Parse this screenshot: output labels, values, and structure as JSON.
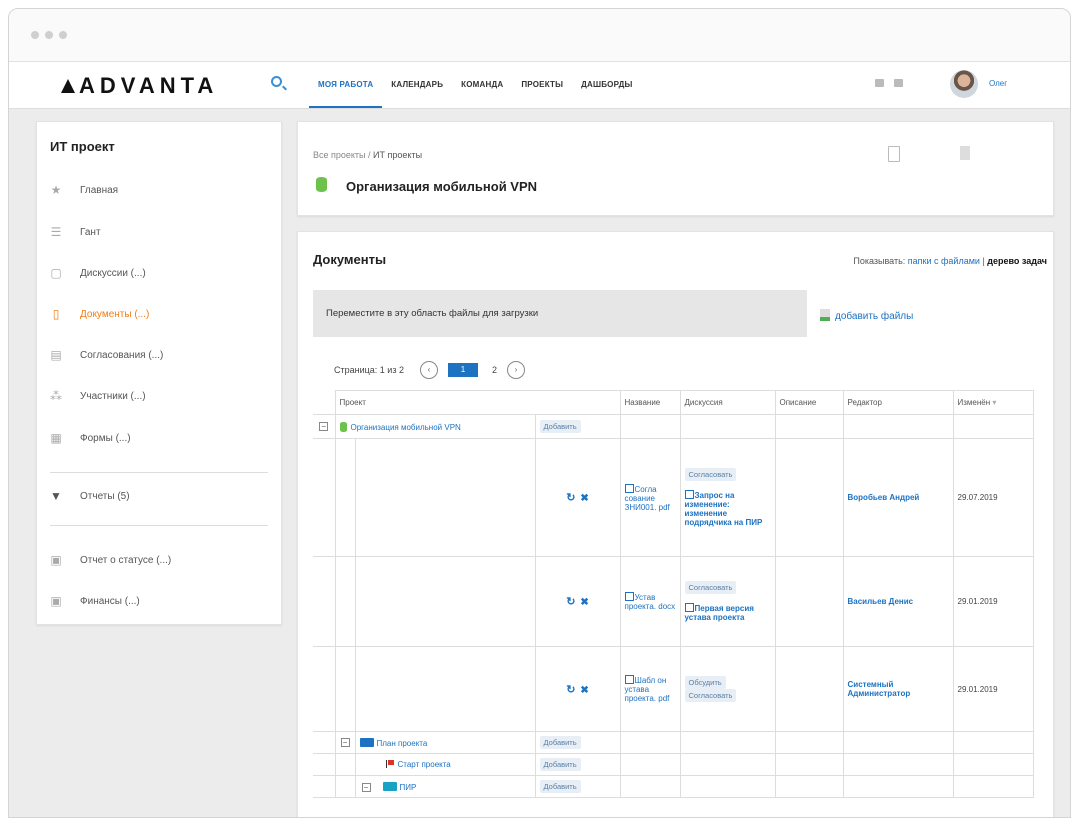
{
  "brand": {
    "logo": "ADVANTA"
  },
  "nav": {
    "items": [
      "МОЯ РАБОТА",
      "КАЛЕНДАРЬ",
      "КОМАНДА",
      "ПРОЕКТЫ",
      "ДАШБОРДЫ"
    ],
    "active": "МОЯ РАБОТА",
    "user": "Олег"
  },
  "sidebar": {
    "title": "ИТ проект",
    "items": [
      {
        "icon": "star-icon",
        "label": "Главная"
      },
      {
        "icon": "gantt-icon",
        "label": "Гант"
      },
      {
        "icon": "chat-icon",
        "label": "Дискуссии (...)"
      },
      {
        "icon": "document-icon",
        "label": "Документы (...)",
        "active": true
      },
      {
        "icon": "checklist-icon",
        "label": "Согласования (...)"
      },
      {
        "icon": "people-icon",
        "label": "Участники (...)"
      },
      {
        "icon": "form-icon",
        "label": "Формы (...)"
      },
      {
        "icon": "triangle-down-icon",
        "label": "Отчеты (5)"
      },
      {
        "icon": "report-icon",
        "label": "Отчет о статусе (...)"
      },
      {
        "icon": "finance-icon",
        "label": "Финансы (...)"
      }
    ]
  },
  "header": {
    "breadcrumb_root": "Все проекты",
    "breadcrumb_sep": " / ",
    "breadcrumb_current": "ИТ проекты",
    "title": "Организация мобильной VPN"
  },
  "documents": {
    "title": "Документы",
    "show_label": "Показывать: ",
    "show_opt1": "папки с файлами",
    "show_sep": " | ",
    "show_opt2": "дерево задач",
    "dropzone": "Переместите в эту область файлы для загрузки",
    "add_files": "добавить файлы",
    "pager_label": "Страница: 1 из 2",
    "page_current": "1",
    "page_next": "2",
    "columns": [
      "Проект",
      "Название",
      "Дискуссия",
      "Описание",
      "Редактор",
      "Изменён"
    ],
    "project_row": {
      "name": "Организация мобильной VPN",
      "add": "Добавить"
    },
    "files": [
      {
        "name": "Согла сование ЗНИ001. pdf",
        "actions": [
          "Согласовать"
        ],
        "discussion": "Запрос на изменение: изменение подрядчика на ПИР",
        "editor": "Воробьев Андрей",
        "date": "29.07.2019"
      },
      {
        "name": "Устав проекта. docx",
        "actions": [
          "Согласовать"
        ],
        "discussion": "Первая версия устава проекта",
        "editor": "Васильев Денис",
        "date": "29.01.2019"
      },
      {
        "name": "Шабл он устава проекта. pdf",
        "actions": [
          "Обсудить",
          "Согласовать"
        ],
        "discussion": "",
        "editor": "Системный Администратор",
        "date": "29.01.2019"
      }
    ],
    "folders": [
      {
        "name": "План проекта",
        "add": "Добавить"
      },
      {
        "name": "Старт проекта",
        "add": "Добавить"
      },
      {
        "name": "ПИР",
        "add": "Добавить"
      }
    ]
  }
}
